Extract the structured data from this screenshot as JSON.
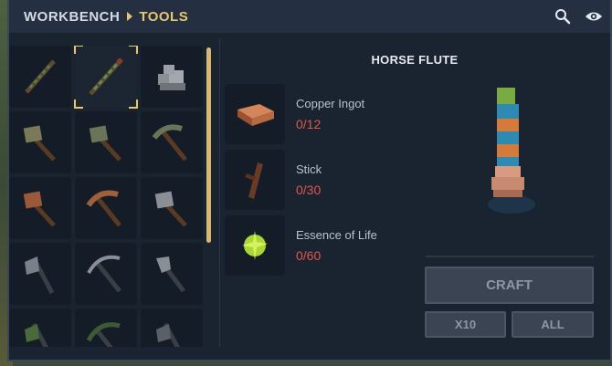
{
  "breadcrumb": {
    "parent": "WORKBENCH",
    "current": "TOOLS"
  },
  "header_icons": [
    "search-icon",
    "eye-icon"
  ],
  "inventory": {
    "slots": [
      {
        "name": "slot-staff-1",
        "icon": "staff"
      },
      {
        "name": "slot-staff-2",
        "icon": "staff",
        "selected": true
      },
      {
        "name": "slot-stone-pile",
        "icon": "stone-pile"
      },
      {
        "name": "slot-stone-hammer",
        "icon": "hammer"
      },
      {
        "name": "slot-stone-hammer-2",
        "icon": "hammer"
      },
      {
        "name": "slot-stone-pickaxe",
        "icon": "pickaxe"
      },
      {
        "name": "slot-copper-hammer",
        "icon": "hammer"
      },
      {
        "name": "slot-copper-pickaxe",
        "icon": "pickaxe"
      },
      {
        "name": "slot-iron-hammer",
        "icon": "hammer"
      },
      {
        "name": "slot-axe",
        "icon": "axe"
      },
      {
        "name": "slot-iron-pickaxe",
        "icon": "pickaxe"
      },
      {
        "name": "slot-shovel",
        "icon": "shovel"
      },
      {
        "name": "slot-green-axe",
        "icon": "axe"
      },
      {
        "name": "slot-green-pickaxe",
        "icon": "pickaxe"
      },
      {
        "name": "slot-dark-axe",
        "icon": "axe"
      }
    ]
  },
  "recipe": {
    "title": "HORSE FLUTE",
    "ingredients": [
      {
        "name": "Copper Ingot",
        "count": "0/12",
        "icon": "copper-ingot-icon"
      },
      {
        "name": "Stick",
        "count": "0/30",
        "icon": "stick-icon"
      },
      {
        "name": "Essence of Life",
        "count": "0/60",
        "icon": "essence-icon"
      }
    ]
  },
  "buttons": {
    "craft": "CRAFT",
    "x10": "X10",
    "all": "ALL"
  },
  "colors": {
    "accent": "#e8c66a",
    "missing": "#e2574c",
    "panel": "#1a2330"
  }
}
